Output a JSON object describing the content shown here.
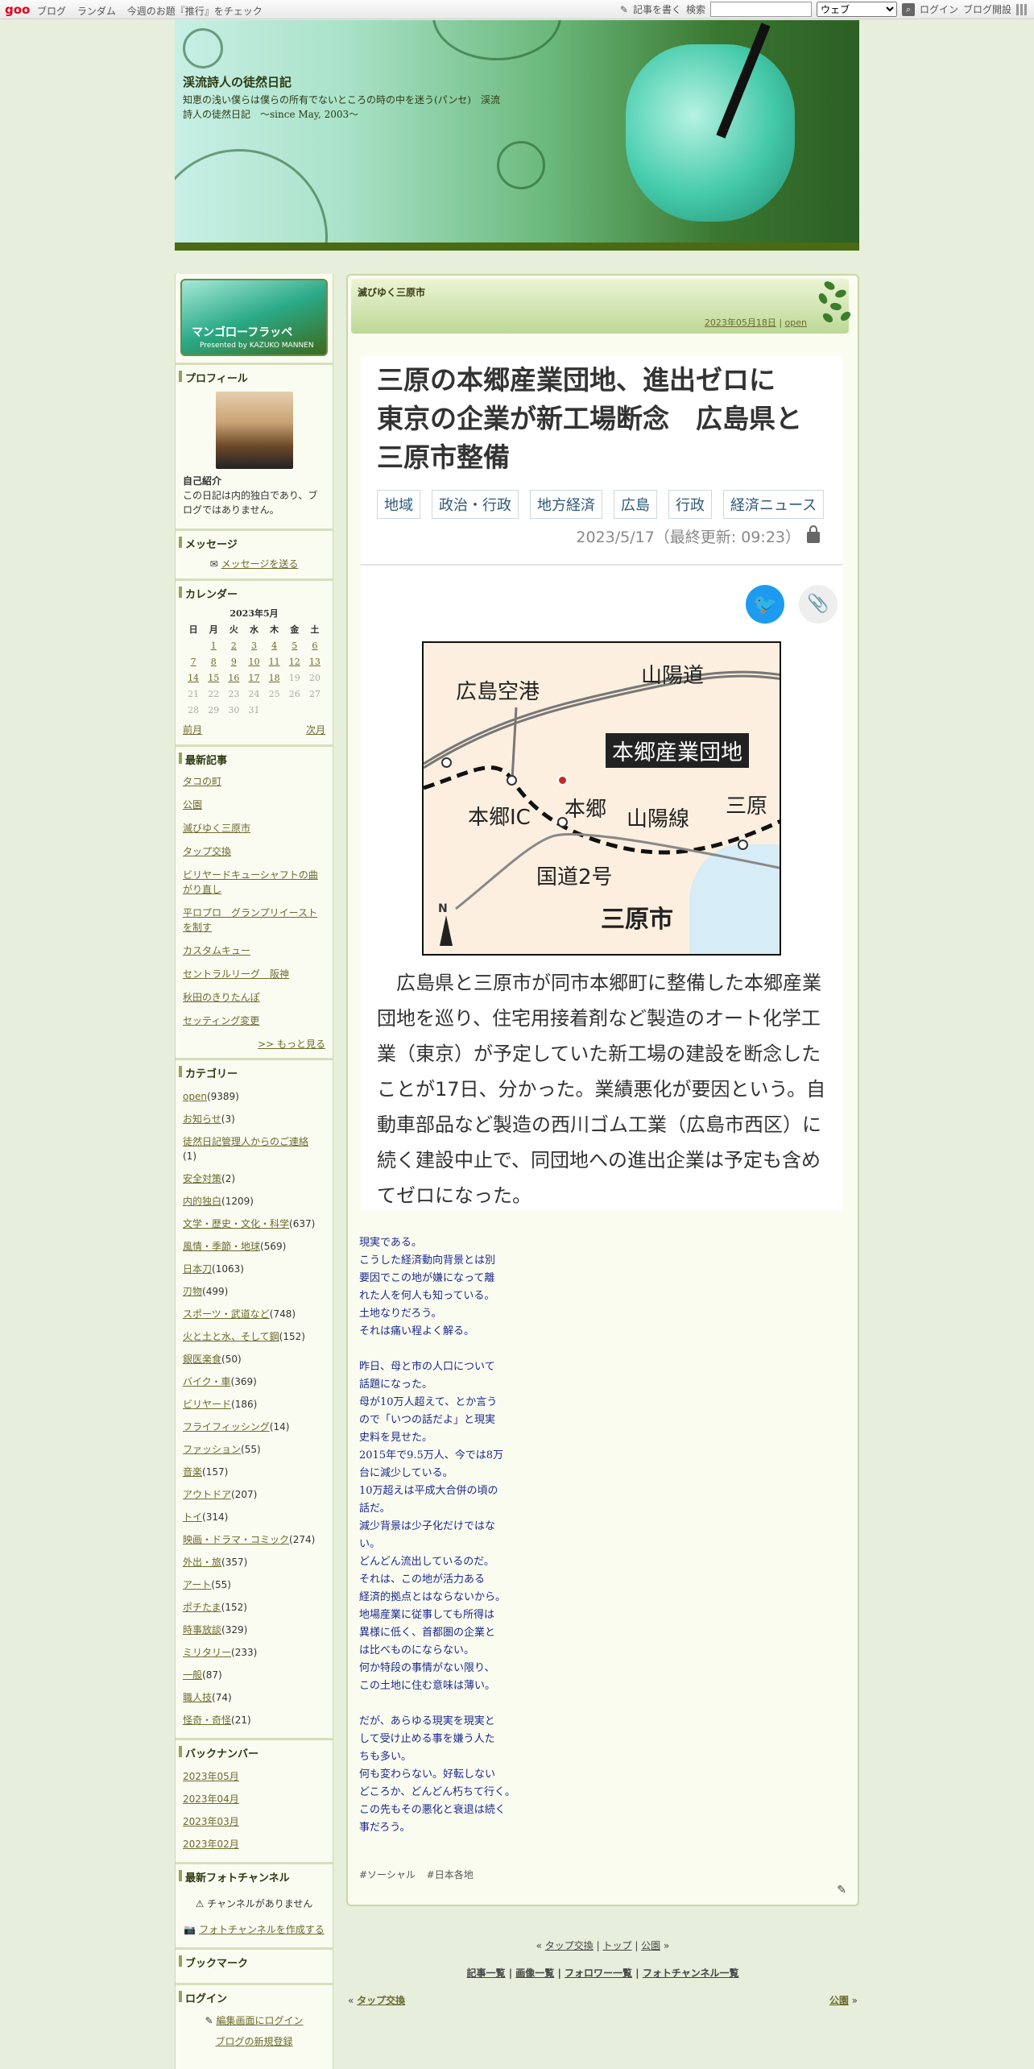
{
  "topbar": {
    "logo": "goo",
    "nav": [
      "ブログ",
      "ランダム",
      "今週のお題『推行』をチェック"
    ],
    "write": "記事を書く",
    "search_label": "検索",
    "search_value": "",
    "search_scope": "ウェブ",
    "login": "ログイン",
    "open_blog": "ブログ開設"
  },
  "header": {
    "title": "渓流詩人の徒然日記",
    "description": "知恵の浅い僕らは僕らの所有でないところの時の中を迷う(パンセ)　渓流詩人の徒然日記　～since May, 2003～"
  },
  "sidebar": {
    "banner": {
      "title": "マンゴ口ーフラッペ",
      "subtitle": "Presented by KAZUKO MANNEN"
    },
    "profile": {
      "heading": "プロフィール",
      "self_intro_label": "自己紹介",
      "self_intro": "この日記は内的独白であり、ブログではありません。"
    },
    "message": {
      "heading": "メッセージ",
      "link": "メッセージを送る"
    },
    "calendar": {
      "heading": "カレンダー",
      "month": "2023年5月",
      "weekdays": [
        "日",
        "月",
        "火",
        "水",
        "木",
        "金",
        "土"
      ],
      "rows": [
        [
          "",
          "1",
          "2",
          "3",
          "4",
          "5",
          "6"
        ],
        [
          "7",
          "8",
          "9",
          "10",
          "11",
          "12",
          "13"
        ],
        [
          "14",
          "15",
          "16",
          "17",
          "18",
          "19",
          "20"
        ],
        [
          "21",
          "22",
          "23",
          "24",
          "25",
          "26",
          "27"
        ],
        [
          "28",
          "29",
          "30",
          "31",
          "",
          "",
          ""
        ]
      ],
      "prev": "前月",
      "next": "次月"
    },
    "recent": {
      "heading": "最新記事",
      "items": [
        "タコの町",
        "公園",
        "滅びゆく三原市",
        "タップ交換",
        "ビリヤードキューシャフトの曲がり直し",
        "平ロプロ　グランプリイーストを制す",
        "カスタムキュー",
        "セントラルリーグ　阪神",
        "秋田のきりたんぽ",
        "セッティング変更"
      ],
      "more": ">> もっと見る"
    },
    "categories": {
      "heading": "カテゴリー",
      "items": [
        {
          "name": "open",
          "count": "(9389)"
        },
        {
          "name": "お知らせ",
          "count": "(3)"
        },
        {
          "name": "徒然日記管理人からのご連絡",
          "count": "(1)"
        },
        {
          "name": "安全対策",
          "count": "(2)"
        },
        {
          "name": "内的独白",
          "count": "(1209)"
        },
        {
          "name": "文学・歴史・文化・科学",
          "count": "(637)"
        },
        {
          "name": "風情・季節・地球",
          "count": "(569)"
        },
        {
          "name": "日本刀",
          "count": "(1063)"
        },
        {
          "name": "刃物",
          "count": "(499)"
        },
        {
          "name": "スポーツ・武道など",
          "count": "(748)"
        },
        {
          "name": "火と土と水、そして鋼",
          "count": "(152)"
        },
        {
          "name": "銀医楽食",
          "count": "(50)"
        },
        {
          "name": "バイク・車",
          "count": "(369)"
        },
        {
          "name": "ビリヤード",
          "count": "(186)"
        },
        {
          "name": "フライフィッシング",
          "count": "(14)"
        },
        {
          "name": "ファッション",
          "count": "(55)"
        },
        {
          "name": "音楽",
          "count": "(157)"
        },
        {
          "name": "アウトドア",
          "count": "(207)"
        },
        {
          "name": "トイ",
          "count": "(314)"
        },
        {
          "name": "映画・ドラマ・コミック",
          "count": "(274)"
        },
        {
          "name": "外出・旅",
          "count": "(357)"
        },
        {
          "name": "アート",
          "count": "(55)"
        },
        {
          "name": "ポチたま",
          "count": "(152)"
        },
        {
          "name": "時事放談",
          "count": "(329)"
        },
        {
          "name": "ミリタリー",
          "count": "(233)"
        },
        {
          "name": "一般",
          "count": "(87)"
        },
        {
          "name": "職人技",
          "count": "(74)"
        },
        {
          "name": "怪奇・奇怪",
          "count": "(21)"
        }
      ]
    },
    "backnumber": {
      "heading": "バックナンバー",
      "items": [
        "2023年05月",
        "2023年04月",
        "2023年03月",
        "2023年02月"
      ]
    },
    "photo": {
      "heading": "最新フォトチャンネル",
      "none": "チャンネルがありません",
      "create": "フォトチャンネルを作成する"
    },
    "bookmark": {
      "heading": "ブックマーク"
    },
    "login": {
      "heading": "ログイン",
      "edit": "編集画面にログイン",
      "new_blog": "ブログの新規登録"
    }
  },
  "entry": {
    "category_title": "滅びゆく三原市",
    "date": "2023年05月18日",
    "sep": "|",
    "category": "open",
    "article": {
      "title": "三原の本郷産業団地、進出ゼロに　東京の企業が新工場断念　広島県と三原市整備",
      "tags": [
        "地域",
        "政治・行政",
        "地方経済",
        "広島",
        "行政",
        "経済ニュース"
      ],
      "date": "2023/5/17（最終更新: 09:23）",
      "map": {
        "labels": [
          "広島空港",
          "山陽道",
          "本郷産業団地",
          "本郷IC",
          "本郷",
          "山陽線",
          "三原",
          "国道2号",
          "三原市",
          "N"
        ]
      },
      "body": "広島県と三原市が同市本郷町に整備した本郷産業団地を巡り、住宅用接着剤など製造のオート化学工業（東京）が予定していた新工場の建設を断念したことが17日、分かった。業績悪化が要因という。自動車部品など製造の西川ゴム工業（広島市西区）に続く建設中止で、同団地への進出企業は予定も含めてゼロになった。"
    },
    "memo": [
      "現実である。",
      "こうした経済動向背景とは別",
      "要因でこの地が嫌になって離",
      "れた人を何人も知っている。",
      "土地なりだろう。",
      "それは痛い程よく解る。",
      "",
      "昨日、母と市の人口について",
      "話題になった。",
      "母が10万人超えて、とか言う",
      "ので「いつの話だよ」と現実",
      "史料を見せた。",
      "2015年で9.5万人、今では8万",
      "台に減少している。",
      "10万超えは平成大合併の頃の",
      "話だ。",
      "減少背景は少子化だけではな",
      "い。",
      "どんどん流出しているのだ。",
      "それは、この地が活力ある",
      "経済的拠点とはならないから。",
      "地場産業に従事しても所得は",
      "異様に低く、首都圏の企業と",
      "は比べものにならない。",
      "何か特段の事情がない限り、",
      "この土地に住む意味は薄い。",
      "",
      "だが、あらゆる現実を現実と",
      "して受け止める事を嫌う人た",
      "ちも多い。",
      "何も変わらない。好転しない",
      "どころか、どんどん朽ちて行く。",
      "この先もその悪化と衰退は続く",
      "事だろう。"
    ],
    "hashtags": [
      "#ソーシャル",
      "#日本各地"
    ]
  },
  "pager": {
    "prev_small": "タップ交換",
    "top": "トップ",
    "next_small": "公園",
    "links": [
      "記事一覧",
      "画像一覧",
      "フォロワー一覧",
      "フォトチャンネル一覧"
    ],
    "prev": "タップ交換",
    "next": "公園"
  }
}
